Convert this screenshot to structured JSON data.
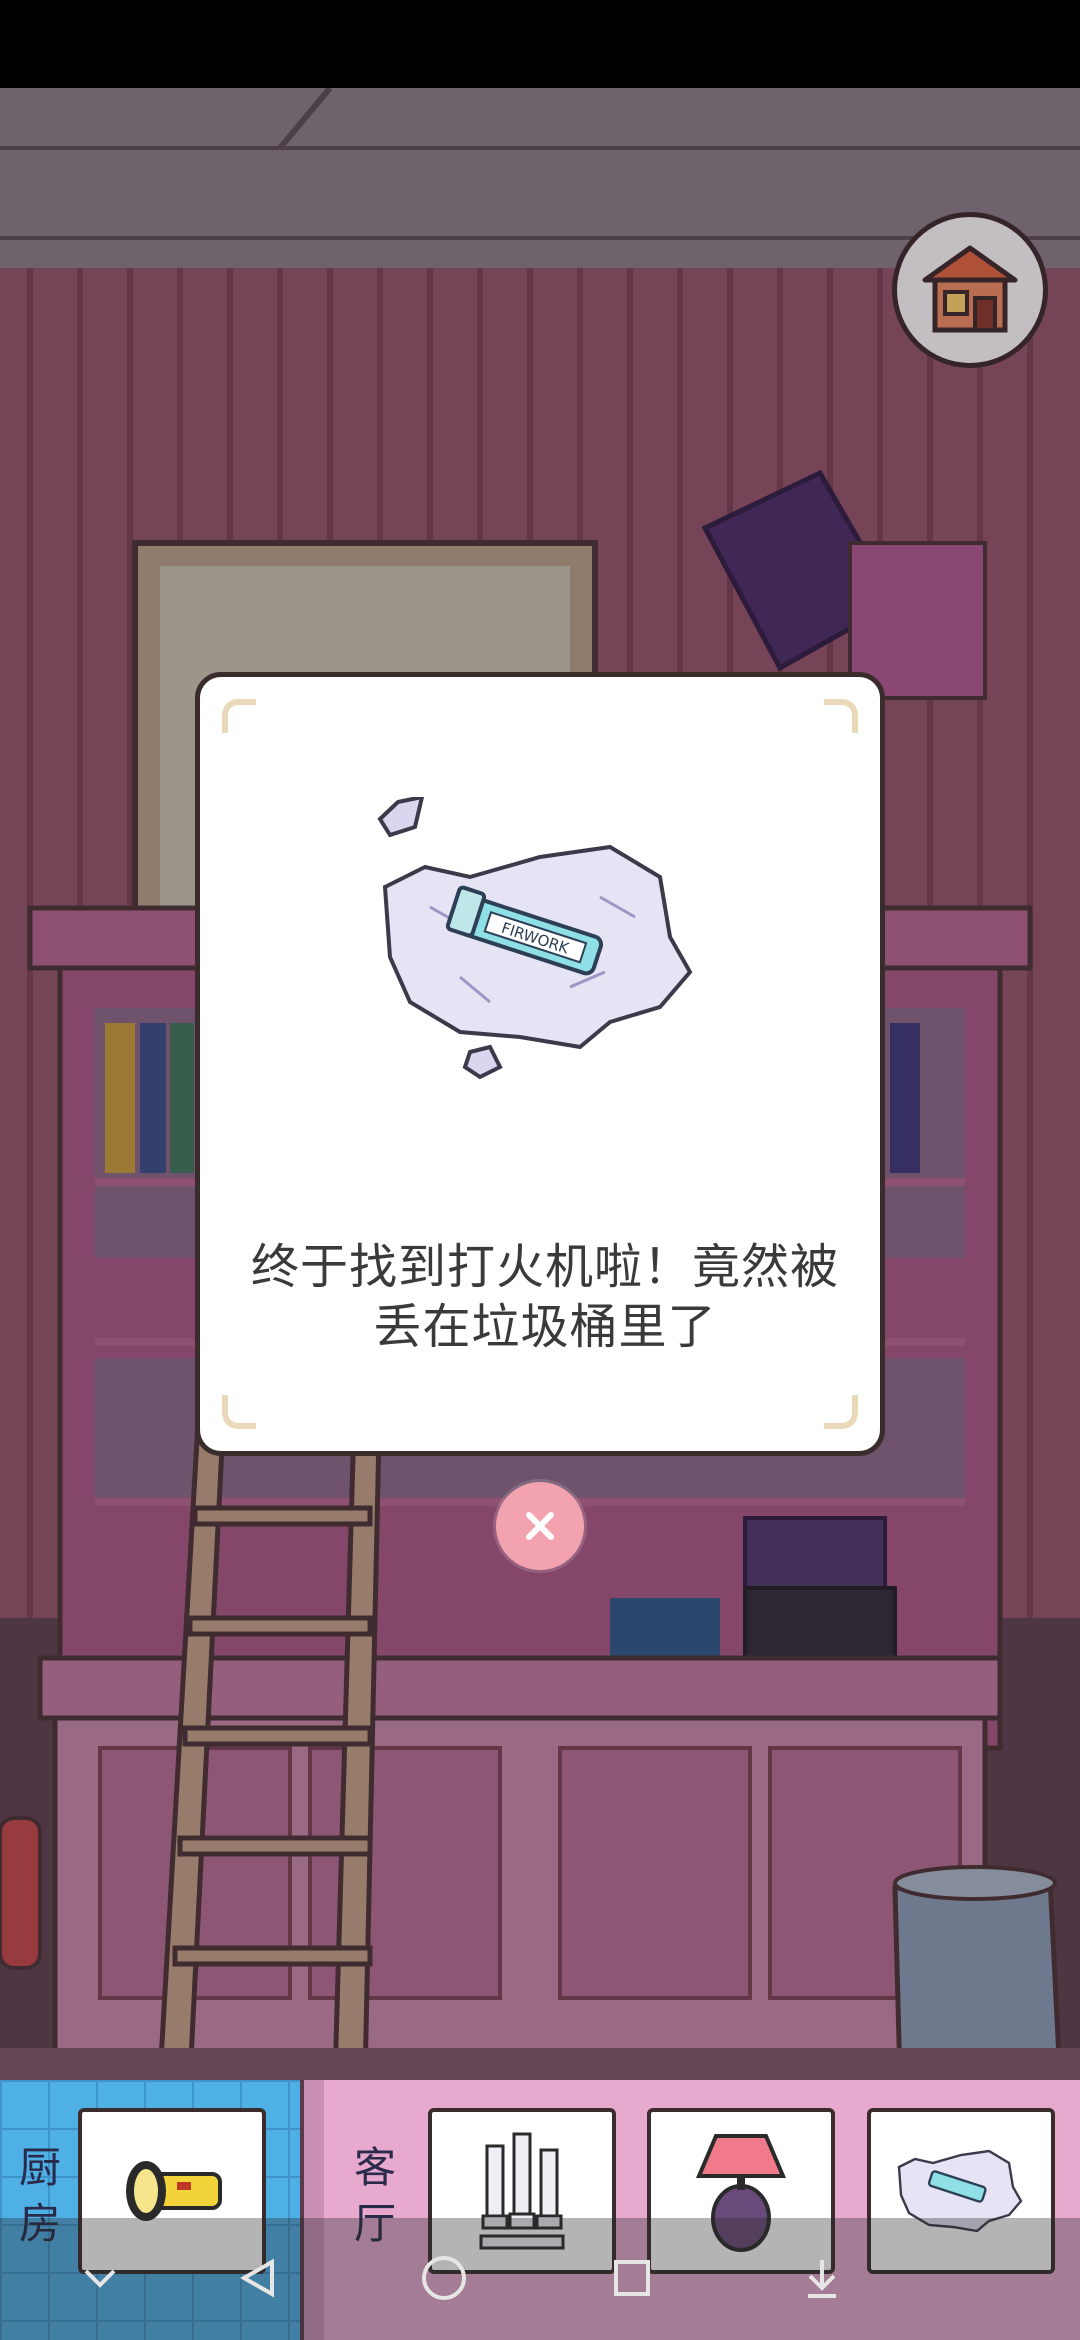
{
  "dialog": {
    "message": "终于找到打火机啦！竟然被丢在垃圾桶里了",
    "item_art_label": "FIRWORK"
  },
  "icons": {
    "home": "house-icon",
    "close": "close-icon",
    "nav_back": "back-triangle-icon",
    "nav_home": "home-circle-icon",
    "nav_recents": "recents-square-icon",
    "nav_collapse": "chevron-down-icon",
    "nav_extra": "download-icon"
  },
  "inventory": {
    "rooms": [
      {
        "label": "厨房",
        "color": "#4fb0e6"
      },
      {
        "label": "客厅",
        "color": "#e8a9cf"
      }
    ],
    "items": [
      {
        "name": "flashlight",
        "room": "厨房"
      },
      {
        "name": "candlesticks",
        "room": "客厅"
      },
      {
        "name": "table-lamp",
        "room": "客厅"
      },
      {
        "name": "lighter-on-paper",
        "room": "客厅"
      }
    ]
  },
  "colors": {
    "close_button": "#f3a2b0",
    "kitchen_tile": "#4fb0e6",
    "living_room_bar": "#e8a9cf"
  }
}
